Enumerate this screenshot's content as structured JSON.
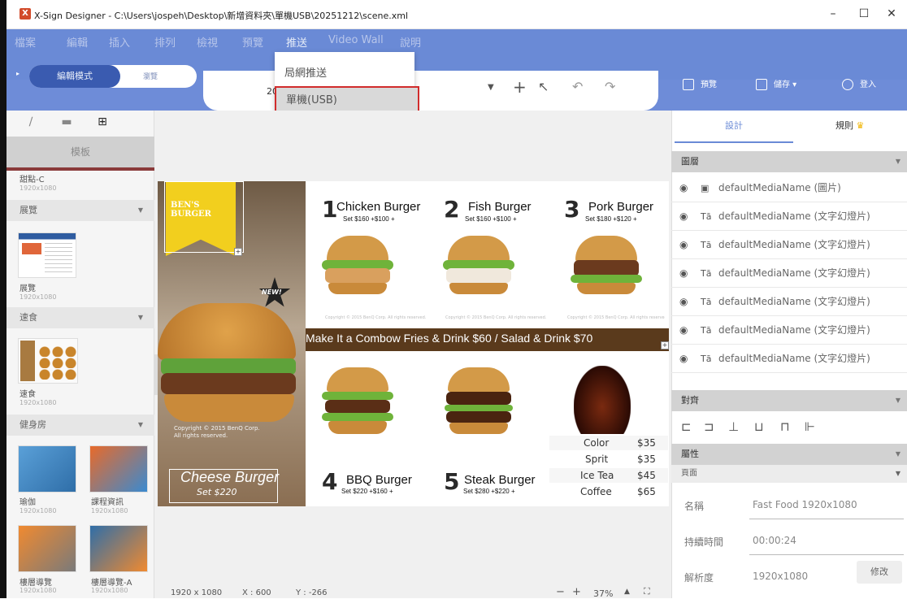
{
  "window": {
    "title": "X-Sign Designer - C:\\Users\\jospeh\\Desktop\\新增資料夾\\單機USB\\20251212\\scene.xml",
    "app_icon": "X",
    "controls": [
      "–",
      "☐",
      "✕"
    ]
  },
  "menu": {
    "items": [
      "檔案",
      "編輯",
      "插入",
      "排列",
      "檢視",
      "預覽",
      "推送",
      "Video Wall",
      "說明"
    ],
    "active": "推送"
  },
  "push_dropdown": {
    "items": [
      "局網推送",
      "單機(USB)"
    ],
    "highlighted": "單機(USB)"
  },
  "mode_toggle": {
    "edit": "編輯模式",
    "browse": "瀏覽"
  },
  "toolbar": {
    "partial_label": "20",
    "preview": "預覽",
    "save": "儲存",
    "login": "登入"
  },
  "left_panel": {
    "header": "模板",
    "top_item": {
      "name": "甜點-C",
      "res": "1920x1080"
    },
    "categories": [
      {
        "label": "展覽",
        "items": [
          {
            "name": "展覽",
            "res": "1920x1080"
          }
        ]
      },
      {
        "label": "速食",
        "items": [
          {
            "name": "速食",
            "res": "1920x1080"
          }
        ]
      },
      {
        "label": "健身房",
        "items": [
          {
            "name": "瑜伽",
            "res": "1920x1080"
          },
          {
            "name": "課程資訊",
            "res": "1920x1080"
          },
          {
            "name": "樓層導覽",
            "res": "1920x1080"
          },
          {
            "name": "樓層導覽-A",
            "res": "1920x1080"
          }
        ]
      }
    ]
  },
  "canvas": {
    "brand": [
      "BEN'S",
      "BURGER"
    ],
    "new_badge": "NEW!",
    "copyright_photo": [
      "Copyright © 2015 BenQ Corp.",
      "All rights reserved."
    ],
    "cheese": {
      "name": "Cheese Burger",
      "set": "Set $220"
    },
    "banner": "Make It a Combow Fries & Drink $60 / Salad & Drink $70",
    "top_items": [
      {
        "num": "1",
        "name": "Chicken Burger",
        "set": "Set $160 +$100 +"
      },
      {
        "num": "2",
        "name": "Fish Burger",
        "set": "Set $160 +$100 +"
      },
      {
        "num": "3",
        "name": "Pork Burger",
        "set": "Set $180 +$120 +"
      }
    ],
    "bottom_items": [
      {
        "num": "4",
        "name": "BBQ Burger",
        "set": "Set $220 +$160 +"
      },
      {
        "num": "5",
        "name": "Steak Burger",
        "set": "Set $280 +$220 +"
      }
    ],
    "drinks": [
      {
        "name": "Color",
        "price": "$35"
      },
      {
        "name": "Sprit",
        "price": "$35"
      },
      {
        "name": "Ice Tea",
        "price": "$45"
      },
      {
        "name": "Coffee",
        "price": "$65"
      }
    ],
    "small_copyright": "Copyright © 2015 BenQ Corp. All rights reserved."
  },
  "status": {
    "resolution": "1920 x 1080",
    "x": "X : 600",
    "y": "Y : -266",
    "zoom": "37%"
  },
  "right_panel": {
    "tabs": [
      "設計",
      "規則"
    ],
    "layers_title": "圖層",
    "layers": [
      {
        "type": "image",
        "name": "defaultMediaName (圖片)"
      },
      {
        "type": "text",
        "name": "defaultMediaName (文字幻燈片)"
      },
      {
        "type": "text",
        "name": "defaultMediaName (文字幻燈片)"
      },
      {
        "type": "text",
        "name": "defaultMediaName (文字幻燈片)"
      },
      {
        "type": "text",
        "name": "defaultMediaName (文字幻燈片)"
      },
      {
        "type": "text",
        "name": "defaultMediaName (文字幻燈片)"
      },
      {
        "type": "text",
        "name": "defaultMediaName (文字幻燈片)"
      }
    ],
    "align_title": "對齊",
    "props_title": "屬性",
    "page_label": "頁面",
    "props": [
      {
        "k": "名稱",
        "v": "Fast Food 1920x1080"
      },
      {
        "k": "持續時間",
        "v": "00:00:24"
      },
      {
        "k": "解析度",
        "v": "1920x1080"
      }
    ],
    "edit_button": "修改"
  },
  "colors": {
    "ribbon": "#6a8ad6",
    "toggle_active": "#3a5bb0",
    "highlight_border": "#d12c2c",
    "banner": "#5a3a1c",
    "crown": "#f0b400"
  }
}
